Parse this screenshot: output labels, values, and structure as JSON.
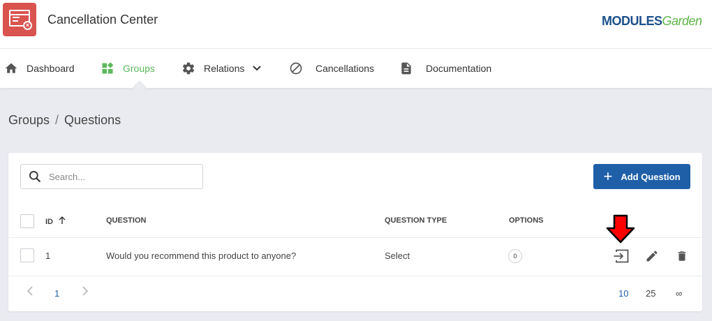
{
  "header": {
    "app_title": "Cancellation Center",
    "brand_part1": "M",
    "brand_part2": "ODULES",
    "brand_part3": "Garden"
  },
  "nav": {
    "items": [
      {
        "label": "Dashboard",
        "icon": "home-icon"
      },
      {
        "label": "Groups",
        "icon": "groups-icon",
        "active": true
      },
      {
        "label": "Relations",
        "icon": "gear-icon"
      },
      {
        "label": "Cancellations",
        "icon": "ban-icon"
      },
      {
        "label": "Documentation",
        "icon": "document-icon"
      }
    ]
  },
  "breadcrumb": {
    "parent": "Groups",
    "separator": "/",
    "current": "Questions"
  },
  "toolbar": {
    "search_placeholder": "Search...",
    "add_label": "Add Question"
  },
  "table": {
    "columns": [
      "ID",
      "QUESTION",
      "QUESTION TYPE",
      "OPTIONS"
    ],
    "rows": [
      {
        "id": "1",
        "question": "Would you recommend this product to anyone?",
        "type": "Select",
        "options": "0"
      }
    ]
  },
  "pagination": {
    "current_page": "1",
    "page_sizes": [
      "10",
      "25",
      "∞"
    ],
    "selected_size": "10"
  },
  "colors": {
    "accent_green": "#5cb85c",
    "primary_blue": "#1f5fa8",
    "logo_red": "#d9534f",
    "annotation_red": "#ff0000"
  }
}
